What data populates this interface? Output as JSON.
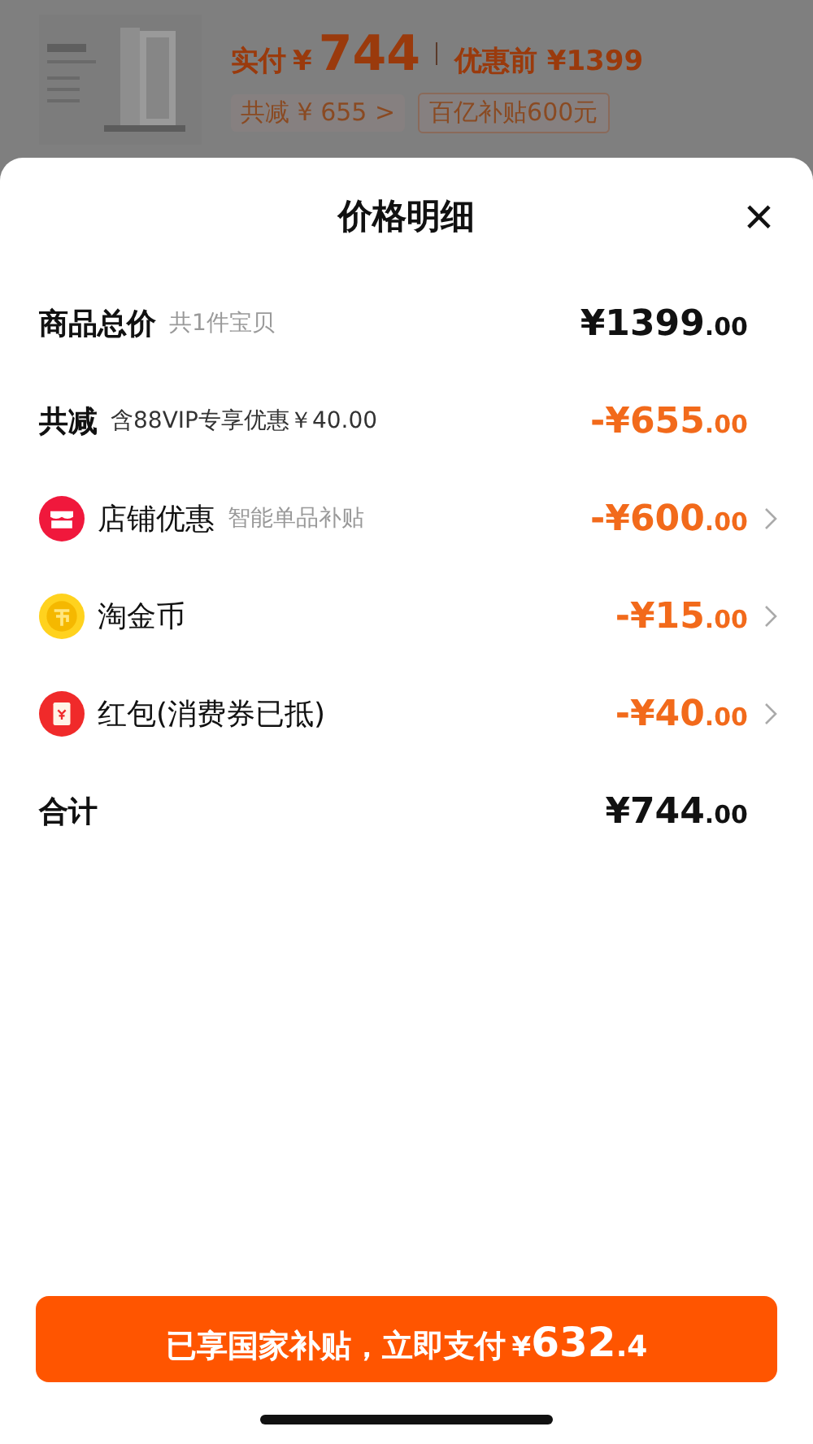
{
  "product_header": {
    "paid_label": "实付",
    "paid_currency": "¥",
    "paid_amount": "744",
    "original_label": "优惠前 ¥1399",
    "reduction_chip": "共减 ¥ 655",
    "reduction_chevron": ">",
    "subsidy_chip": "百亿补贴600元"
  },
  "sheet": {
    "title": "价格明细",
    "close": "×",
    "rows": [
      {
        "kind": "summary",
        "label": "商品总价",
        "note": "共1件宝贝",
        "price": "¥1399",
        "decimals": ".00"
      },
      {
        "kind": "reduction",
        "label": "共减",
        "note": "含88VIP专享优惠￥40.00",
        "price": "-¥655",
        "decimals": ".00"
      },
      {
        "kind": "sub",
        "label": "店铺优惠",
        "note": "智能单品补贴",
        "price": "-¥600",
        "decimals": ".00"
      },
      {
        "kind": "sub",
        "label": "淘金币",
        "price": "-¥15",
        "decimals": ".00"
      },
      {
        "kind": "sub",
        "label": "红包(消费券已抵)",
        "price": "-¥40",
        "decimals": ".00"
      },
      {
        "kind": "summary",
        "label": "合计",
        "price": "¥744",
        "decimals": ".00"
      }
    ],
    "pay_button": {
      "label": "已享国家补贴，立即支付",
      "currency": "¥",
      "amount": "632",
      "decimals": ".4"
    }
  }
}
